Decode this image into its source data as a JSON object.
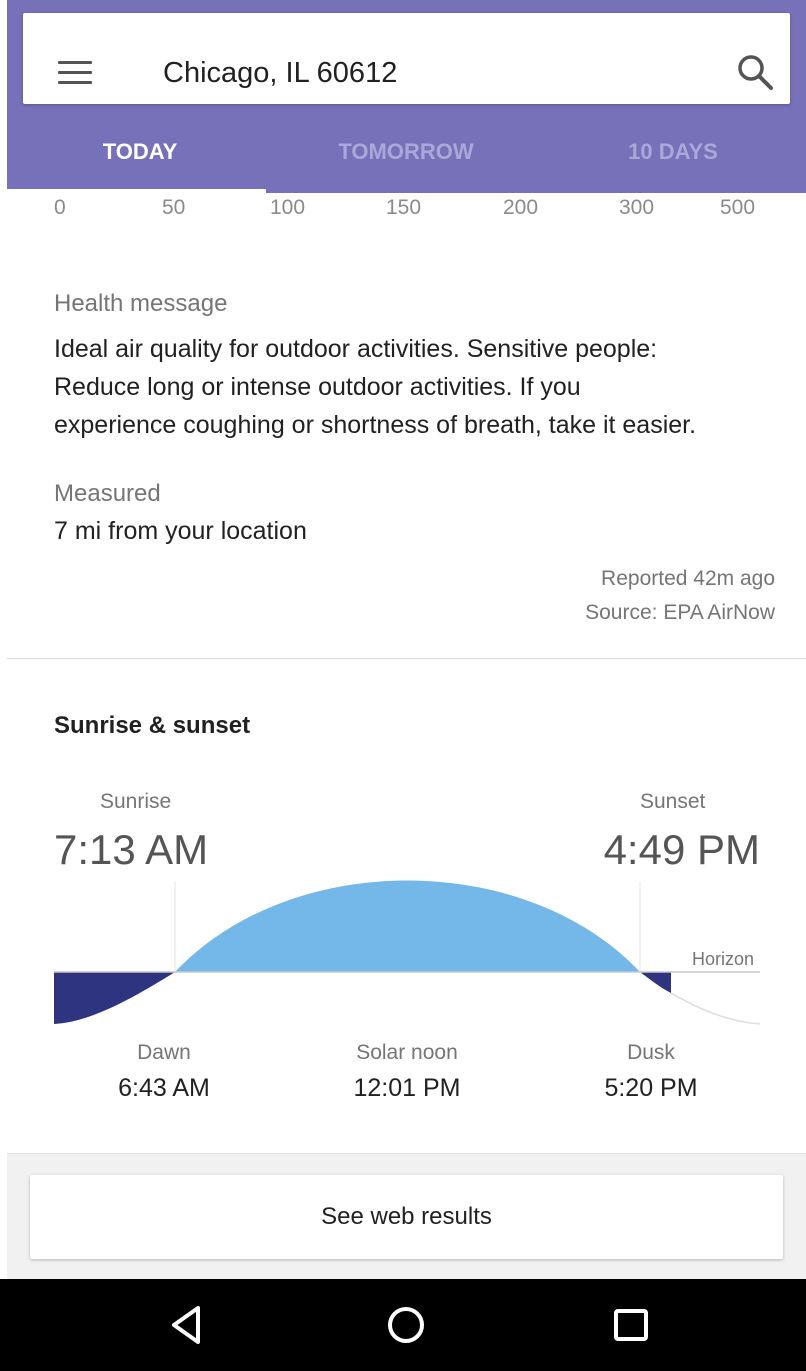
{
  "search": {
    "location": "Chicago, IL 60612"
  },
  "tabs": [
    {
      "label": "TODAY",
      "active": true
    },
    {
      "label": "TOMORROW",
      "active": false
    },
    {
      "label": "10 DAYS",
      "active": false
    }
  ],
  "aqi_scale": [
    "0",
    "50",
    "100",
    "150",
    "200",
    "300",
    "500"
  ],
  "health": {
    "label": "Health message",
    "lines": [
      "Ideal air quality for outdoor activities. Sensitive people:",
      "Reduce long or intense outdoor activities. If you",
      "experience coughing or shortness of breath, take it easier."
    ]
  },
  "measured": {
    "label": "Measured",
    "value": "7 mi from your location"
  },
  "report": {
    "reported": "Reported 42m ago",
    "source": "Source: EPA AirNow"
  },
  "sun": {
    "title": "Sunrise & sunset",
    "sunrise_label": "Sunrise",
    "sunrise_time": "7:13 AM",
    "sunset_label": "Sunset",
    "sunset_time": "4:49 PM",
    "horizon_label": "Horizon",
    "dawn_label": "Dawn",
    "dawn_time": "6:43 AM",
    "noon_label": "Solar noon",
    "noon_time": "12:01 PM",
    "dusk_label": "Dusk",
    "dusk_time": "5:20 PM"
  },
  "footer": {
    "web_results": "See web results"
  },
  "colors": {
    "header": "#7671b8",
    "daylight": "#74b8ea",
    "twilight": "#2f3480"
  },
  "icons": {
    "menu": "menu-icon",
    "search": "search-icon",
    "back": "back-triangle-icon",
    "home": "home-circle-icon",
    "recents": "recents-square-icon"
  }
}
